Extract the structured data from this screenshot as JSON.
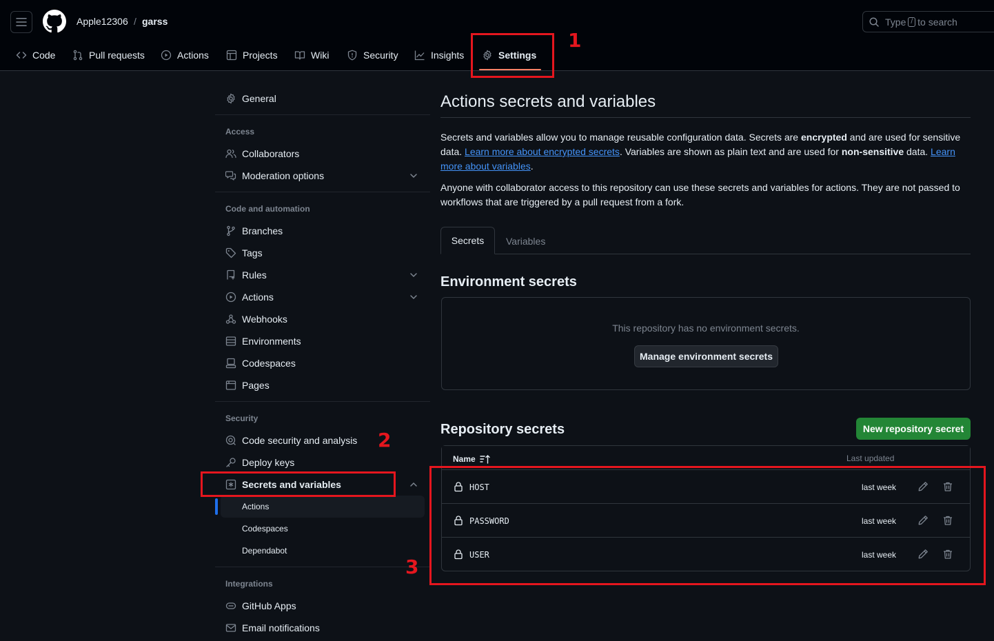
{
  "header": {
    "owner": "Apple12306",
    "separator": "/",
    "repo": "garss",
    "search_prefix": "Type",
    "search_key": "/",
    "search_suffix": "to search"
  },
  "repo_nav": {
    "code": "Code",
    "pull_requests": "Pull requests",
    "actions": "Actions",
    "projects": "Projects",
    "wiki": "Wiki",
    "security": "Security",
    "insights": "Insights",
    "settings": "Settings"
  },
  "sidebar": {
    "general": "General",
    "access_heading": "Access",
    "collaborators": "Collaborators",
    "moderation": "Moderation options",
    "code_heading": "Code and automation",
    "branches": "Branches",
    "tags": "Tags",
    "rules": "Rules",
    "actions": "Actions",
    "webhooks": "Webhooks",
    "environments": "Environments",
    "codespaces": "Codespaces",
    "pages": "Pages",
    "security_heading": "Security",
    "code_security": "Code security and analysis",
    "deploy_keys": "Deploy keys",
    "secrets_vars": "Secrets and variables",
    "sub_actions": "Actions",
    "sub_codespaces": "Codespaces",
    "sub_dependabot": "Dependabot",
    "integrations_heading": "Integrations",
    "github_apps": "GitHub Apps",
    "email_notifications": "Email notifications"
  },
  "main": {
    "title": "Actions secrets and variables",
    "p1_a": "Secrets and variables allow you to manage reusable configuration data. Secrets are ",
    "p1_b": "encrypted",
    "p1_c": " and are used for sensitive data. ",
    "p1_link1": "Learn more about encrypted secrets",
    "p1_d": ". Variables are shown as plain text and are used for ",
    "p1_e": "non-sensitive",
    "p1_f": " data. ",
    "p1_link2": "Learn more about variables",
    "p1_g": ".",
    "p2": "Anyone with collaborator access to this repository can use these secrets and variables for actions. They are not passed to workflows that are triggered by a pull request from a fork.",
    "tab_secrets": "Secrets",
    "tab_variables": "Variables",
    "env_title": "Environment secrets",
    "env_empty": "This repository has no environment secrets.",
    "env_button": "Manage environment secrets",
    "repo_title": "Repository secrets",
    "new_button": "New repository secret",
    "col_name": "Name",
    "col_updated": "Last updated",
    "rows": [
      {
        "name": "HOST",
        "updated": "last week"
      },
      {
        "name": "PASSWORD",
        "updated": "last week"
      },
      {
        "name": "USER",
        "updated": "last week"
      }
    ]
  },
  "annotations": {
    "n1": "1",
    "n2": "2",
    "n3": "3",
    "color": "#e5161e"
  }
}
